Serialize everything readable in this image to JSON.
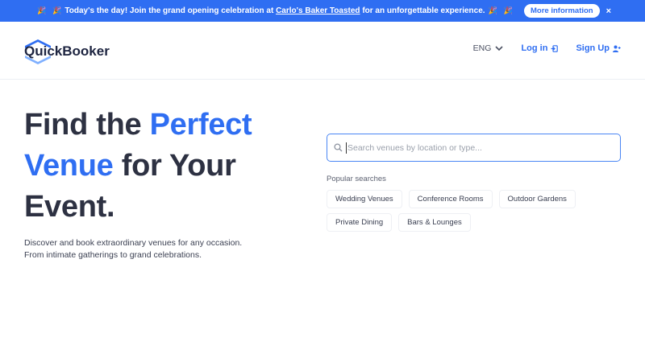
{
  "banner": {
    "confetti": "🎉",
    "message_prefix": "Today's the day! Join the grand opening celebration at",
    "message_link": "Carlo's Baker Toasted",
    "message_suffix": "for an unforgettable experience.",
    "more_button": "More information",
    "close": "×"
  },
  "header": {
    "logo_text": "QuickBooker",
    "language": "ENG",
    "login": "Log in",
    "signup": "Sign Up"
  },
  "hero": {
    "title_part1": "Find the ",
    "title_highlight1": "Perfect",
    "title_highlight2": "Venue",
    "title_part2": " for Your Event.",
    "subtitle_line1": "Discover and book extraordinary venues for any occasion.",
    "subtitle_line2": "From intimate gatherings to grand celebrations."
  },
  "search": {
    "placeholder": "Search venues by location or type...",
    "popular_label": "Popular searches",
    "popular": [
      [
        "Wedding Venues",
        "Conference Rooms",
        "Outdoor Gardens"
      ],
      [
        "Private Dining",
        "Bars & Lounges"
      ]
    ]
  },
  "colors": {
    "brand_blue": "#2f6ef2",
    "text_dark": "#2d3142"
  },
  "icons": {
    "banner": "party-popper-icon",
    "language": "chevron-down-icon",
    "login": "login-icon",
    "signup": "user-plus-icon",
    "search": "search-icon",
    "close": "close-icon"
  }
}
